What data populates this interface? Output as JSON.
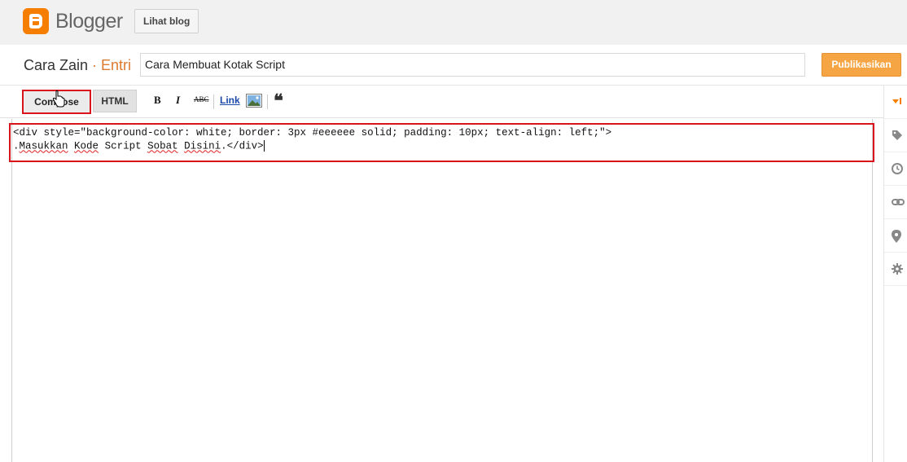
{
  "app": {
    "logo_text": "Blogger",
    "view_blog_label": "Lihat blog"
  },
  "post": {
    "blog_name": "Cara Zain",
    "separator": " · ",
    "section": "Entri",
    "title_value": "Cara Membuat Kotak Script",
    "publish_label": "Publikasikan"
  },
  "toolbar": {
    "compose_label": "Compose",
    "html_label": "HTML",
    "bold_label": "B",
    "italic_label": "I",
    "spell_label": "ABC",
    "link_label": "Link",
    "quote_label": "❝"
  },
  "editor": {
    "line1": "<div style=\"background-color: white; border: 3px #eeeeee solid; padding: 10px; text-align: left;\">",
    "line2_parts": {
      "p0": ".",
      "p1": "Masukkan",
      "p2": " ",
      "p3": "Kode",
      "p4": " Script ",
      "p5": "Sobat",
      "p6": " ",
      "p7": "Disini",
      "p8": ".</div>"
    }
  },
  "sidebar": {
    "icons": [
      "expand-arrow-icon",
      "tag-icon",
      "clock-icon",
      "link-icon",
      "location-icon",
      "gear-icon"
    ]
  },
  "colors": {
    "accent": "#f5a543",
    "highlight": "#d9141c",
    "brand": "#f57d00"
  }
}
